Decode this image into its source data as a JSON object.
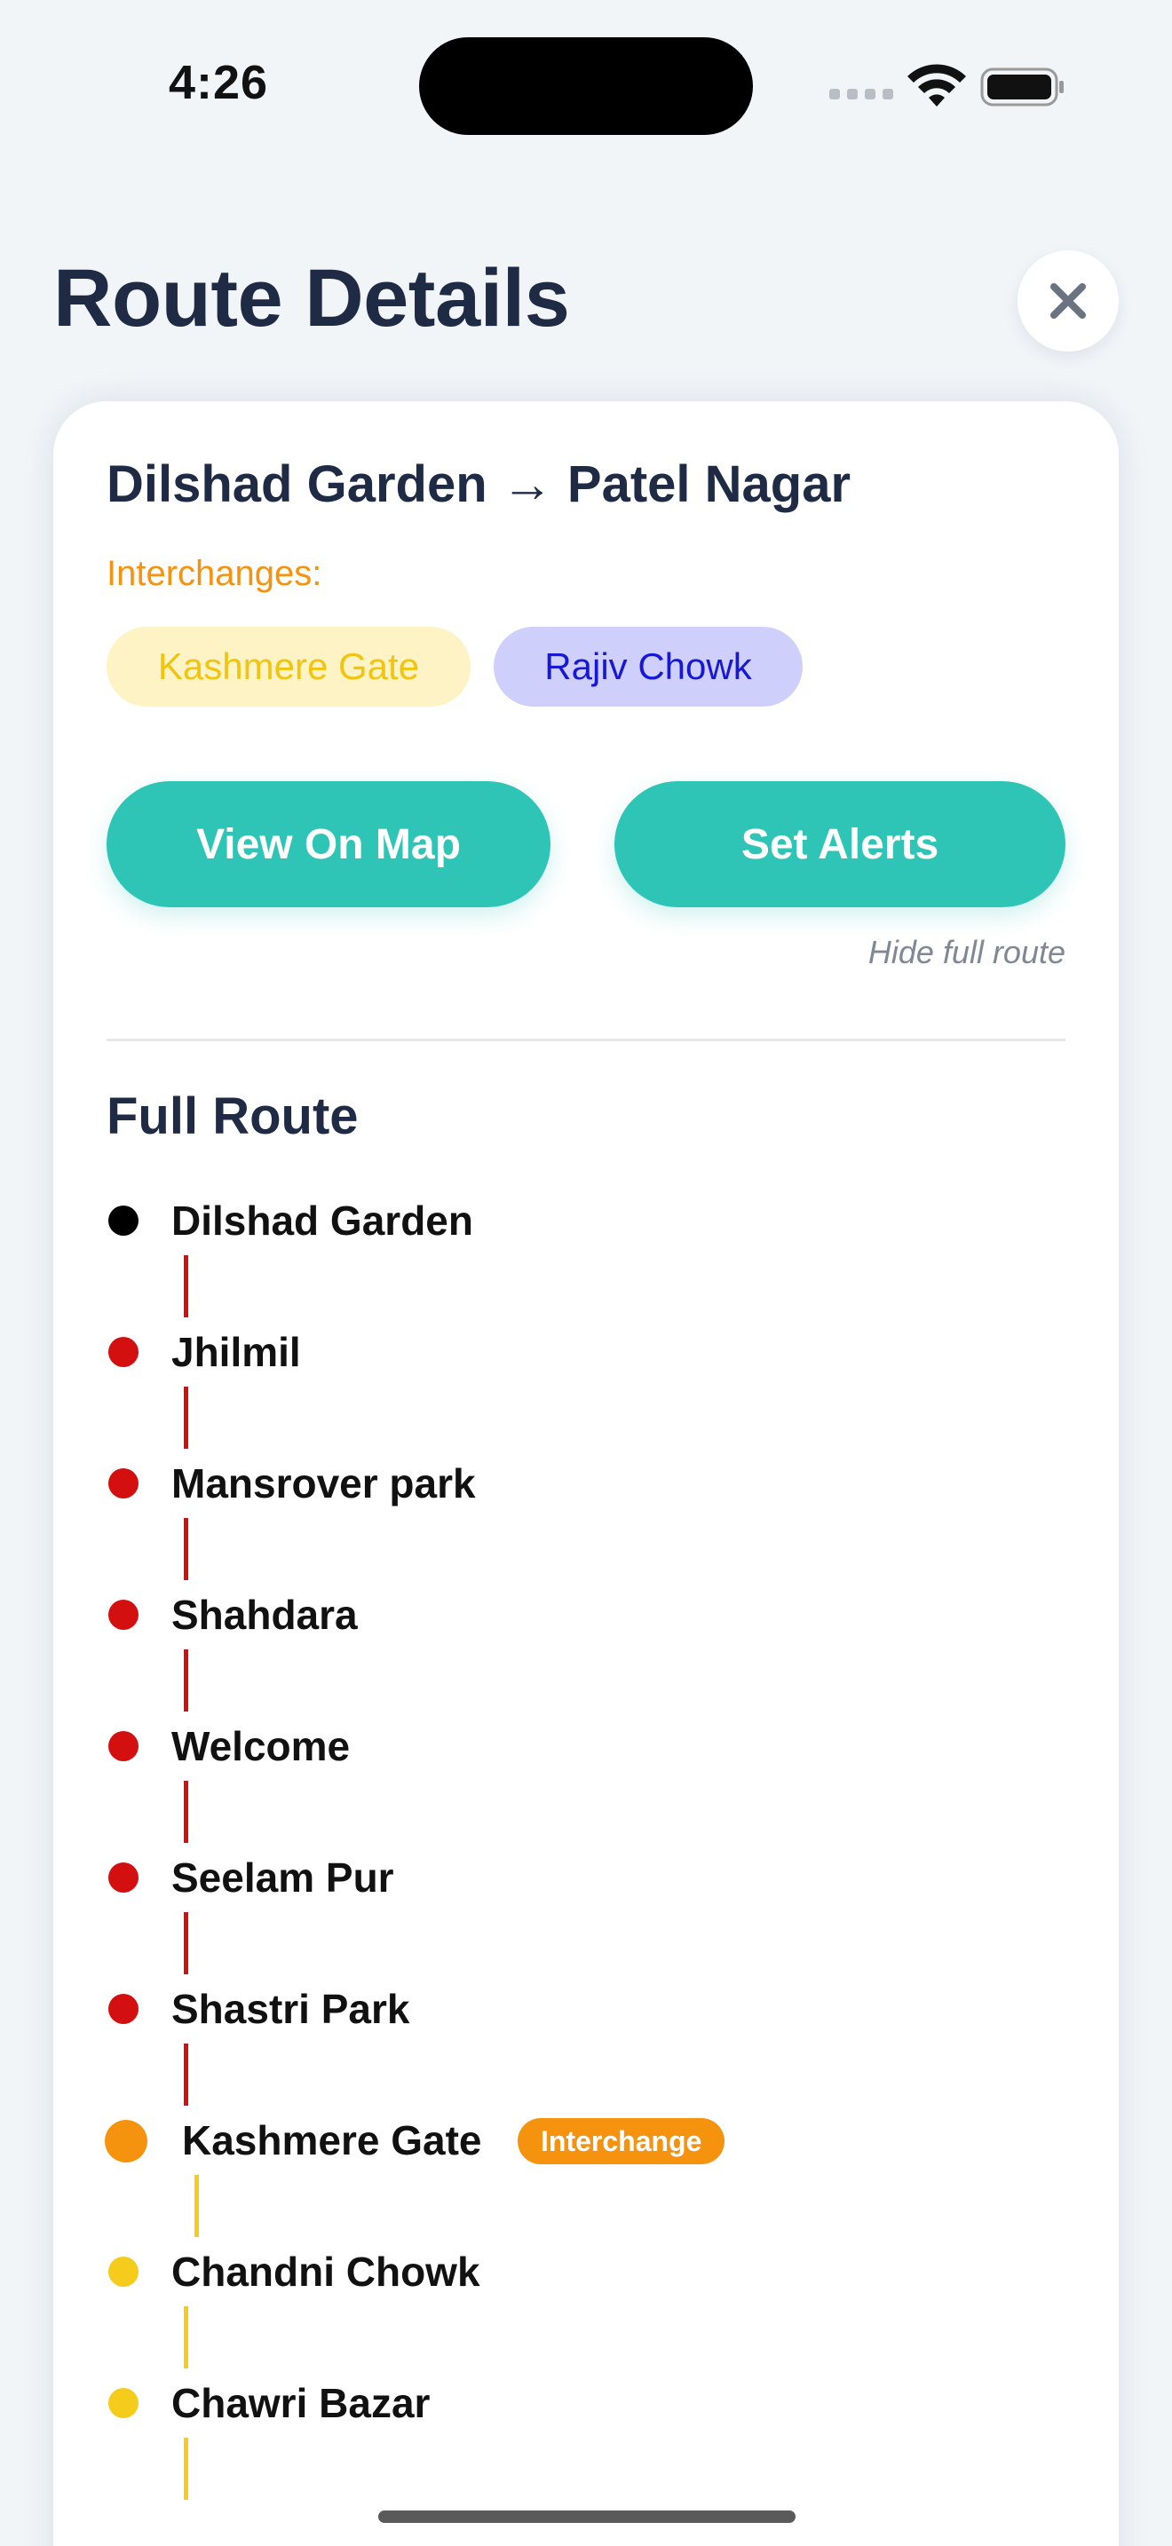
{
  "status_bar": {
    "time": "4:26"
  },
  "header": {
    "title": "Route Details",
    "close_icon": "close-icon"
  },
  "route": {
    "title": "Dilshad Garden → Patel Nagar",
    "interchanges_label": "Interchanges:",
    "interchanges": [
      {
        "name": "Kashmere Gate",
        "text_color": "#f1c40f",
        "bg_color": "#fdf3c4"
      },
      {
        "name": "Rajiv Chowk",
        "text_color": "#1717d6",
        "bg_color": "#cfcffb"
      }
    ],
    "actions": {
      "view_map": "View On Map",
      "set_alerts": "Set Alerts"
    },
    "hide_full_route": "Hide full route"
  },
  "full_route": {
    "title": "Full Route",
    "badge_label": "Interchange",
    "stops": [
      {
        "name": "Dilshad Garden",
        "dot_color": "#000000",
        "line_color": "#d30f0f",
        "interchange": false
      },
      {
        "name": "Jhilmil",
        "dot_color": "#d30f0f",
        "line_color": "#d30f0f",
        "interchange": false
      },
      {
        "name": "Mansrover park",
        "dot_color": "#d30f0f",
        "line_color": "#d30f0f",
        "interchange": false
      },
      {
        "name": "Shahdara",
        "dot_color": "#d30f0f",
        "line_color": "#d30f0f",
        "interchange": false
      },
      {
        "name": "Welcome",
        "dot_color": "#d30f0f",
        "line_color": "#d30f0f",
        "interchange": false
      },
      {
        "name": "Seelam Pur",
        "dot_color": "#d30f0f",
        "line_color": "#d30f0f",
        "interchange": false
      },
      {
        "name": "Shastri Park",
        "dot_color": "#d30f0f",
        "line_color": "#d30f0f",
        "interchange": false
      },
      {
        "name": "Kashmere Gate",
        "dot_color": "#f5930f",
        "line_color": "#f5cc1c",
        "interchange": true
      },
      {
        "name": "Chandni Chowk",
        "dot_color": "#f5cc1c",
        "line_color": "#f5cc1c",
        "interchange": false
      },
      {
        "name": "Chawri Bazar",
        "dot_color": "#f5cc1c",
        "line_color": "#f5cc1c",
        "interchange": false
      }
    ]
  },
  "colors": {
    "accent": "#2ec5b6",
    "interchange_orange": "#f5930f",
    "title_navy": "#1f2a44"
  }
}
